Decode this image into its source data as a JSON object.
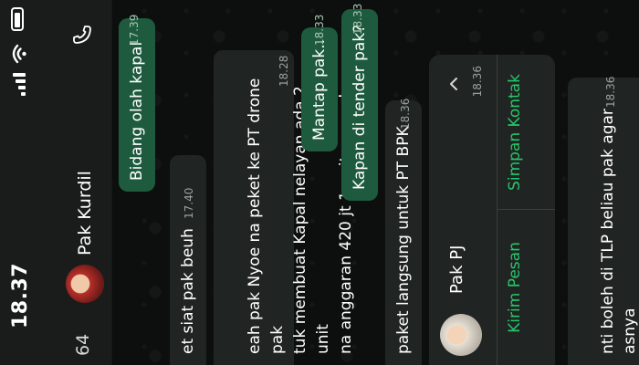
{
  "status_bar": {
    "time": "18.37"
  },
  "header": {
    "back_count": "64",
    "contact_name": "Pak Kurdil"
  },
  "messages": [
    {
      "dir": "out",
      "text": "Bidang olah kapal",
      "time": "17.39"
    },
    {
      "dir": "in",
      "text": "et siat pak beuh",
      "time": "17.40"
    },
    {
      "dir": "in",
      "text": "eah pak Nyoe na peket ke PT drone pak\ntuk membuat Kapal nelayan ada 2 unit\nna anggaran 420 jt 1 unit nya pak",
      "time": "18.28"
    },
    {
      "dir": "out",
      "text": "Mantap pak..",
      "time": "18.33"
    },
    {
      "dir": "out",
      "text": "Kapan di tender pak?",
      "time": "18.33"
    },
    {
      "dir": "in",
      "text": "paket langsung untuk PT BPK",
      "time": "18.36"
    },
    {
      "dir": "in",
      "text": "nti boleh di TLP beliau pak agar\nasnya",
      "time": "18.36"
    }
  ],
  "contact_card": {
    "name": "Pak PJ",
    "time": "18.36",
    "send_label": "Kirim Pesan",
    "save_label": "Simpan Kontak"
  }
}
